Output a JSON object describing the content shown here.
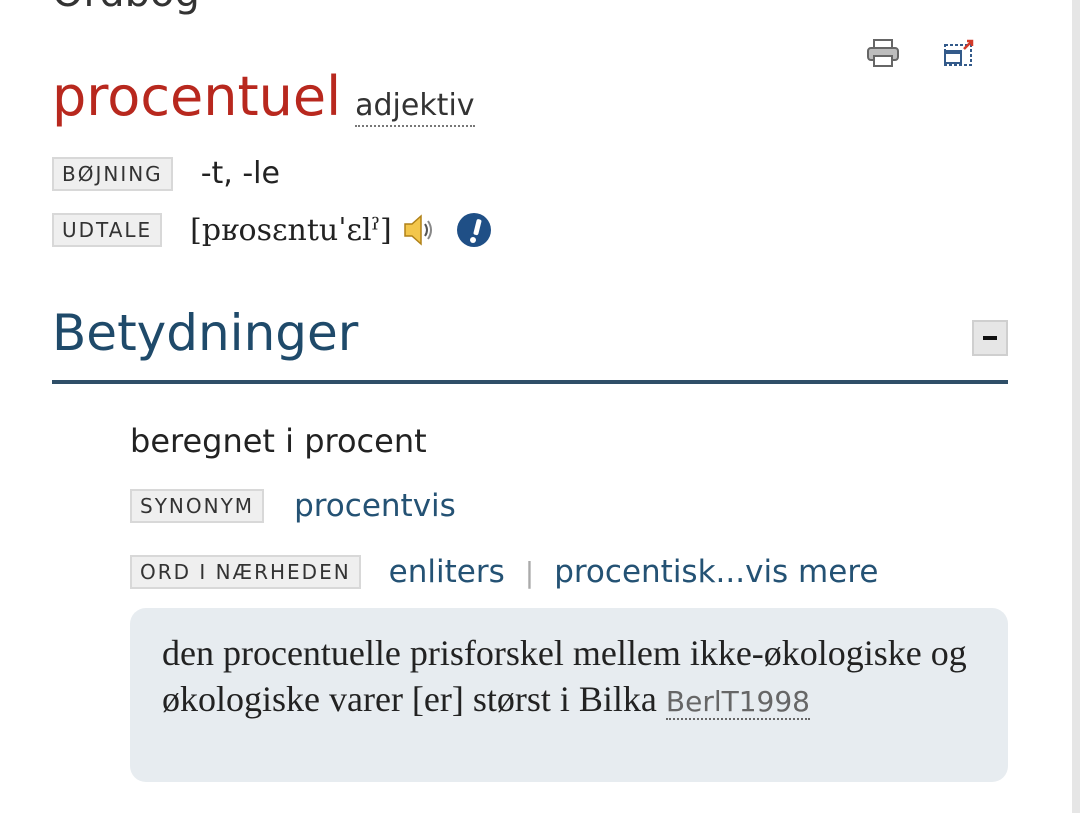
{
  "top_clip_text": "Ordbog",
  "tools": {
    "print_icon": "printer-icon",
    "popout_icon": "popout-window-icon"
  },
  "entry": {
    "headword": "procentuel",
    "word_class": "adjektiv",
    "inflection_label": "BØJNING",
    "inflection_value": "-t, -le",
    "pronunciation_label": "UDTALE",
    "pronunciation_value": "[pʁosɛntuˈɛlˀ]"
  },
  "meanings": {
    "section_title": "Betydninger",
    "definition": "beregnet i procent",
    "synonym_label": "SYNONYM",
    "synonym_value": "procentvis",
    "nearby_label": "ORD I NÆRHEDEN",
    "nearby_words": [
      "enliters",
      "procentisk...vis mere"
    ],
    "example_text": "den procentuelle prisforskel mellem ikke-økologiske og økologiske varer [er] størst i Bilka",
    "example_source": "BerlT1998"
  },
  "colors": {
    "headword": "#b8281e",
    "section": "#1f4a6a",
    "link": "#245274"
  }
}
